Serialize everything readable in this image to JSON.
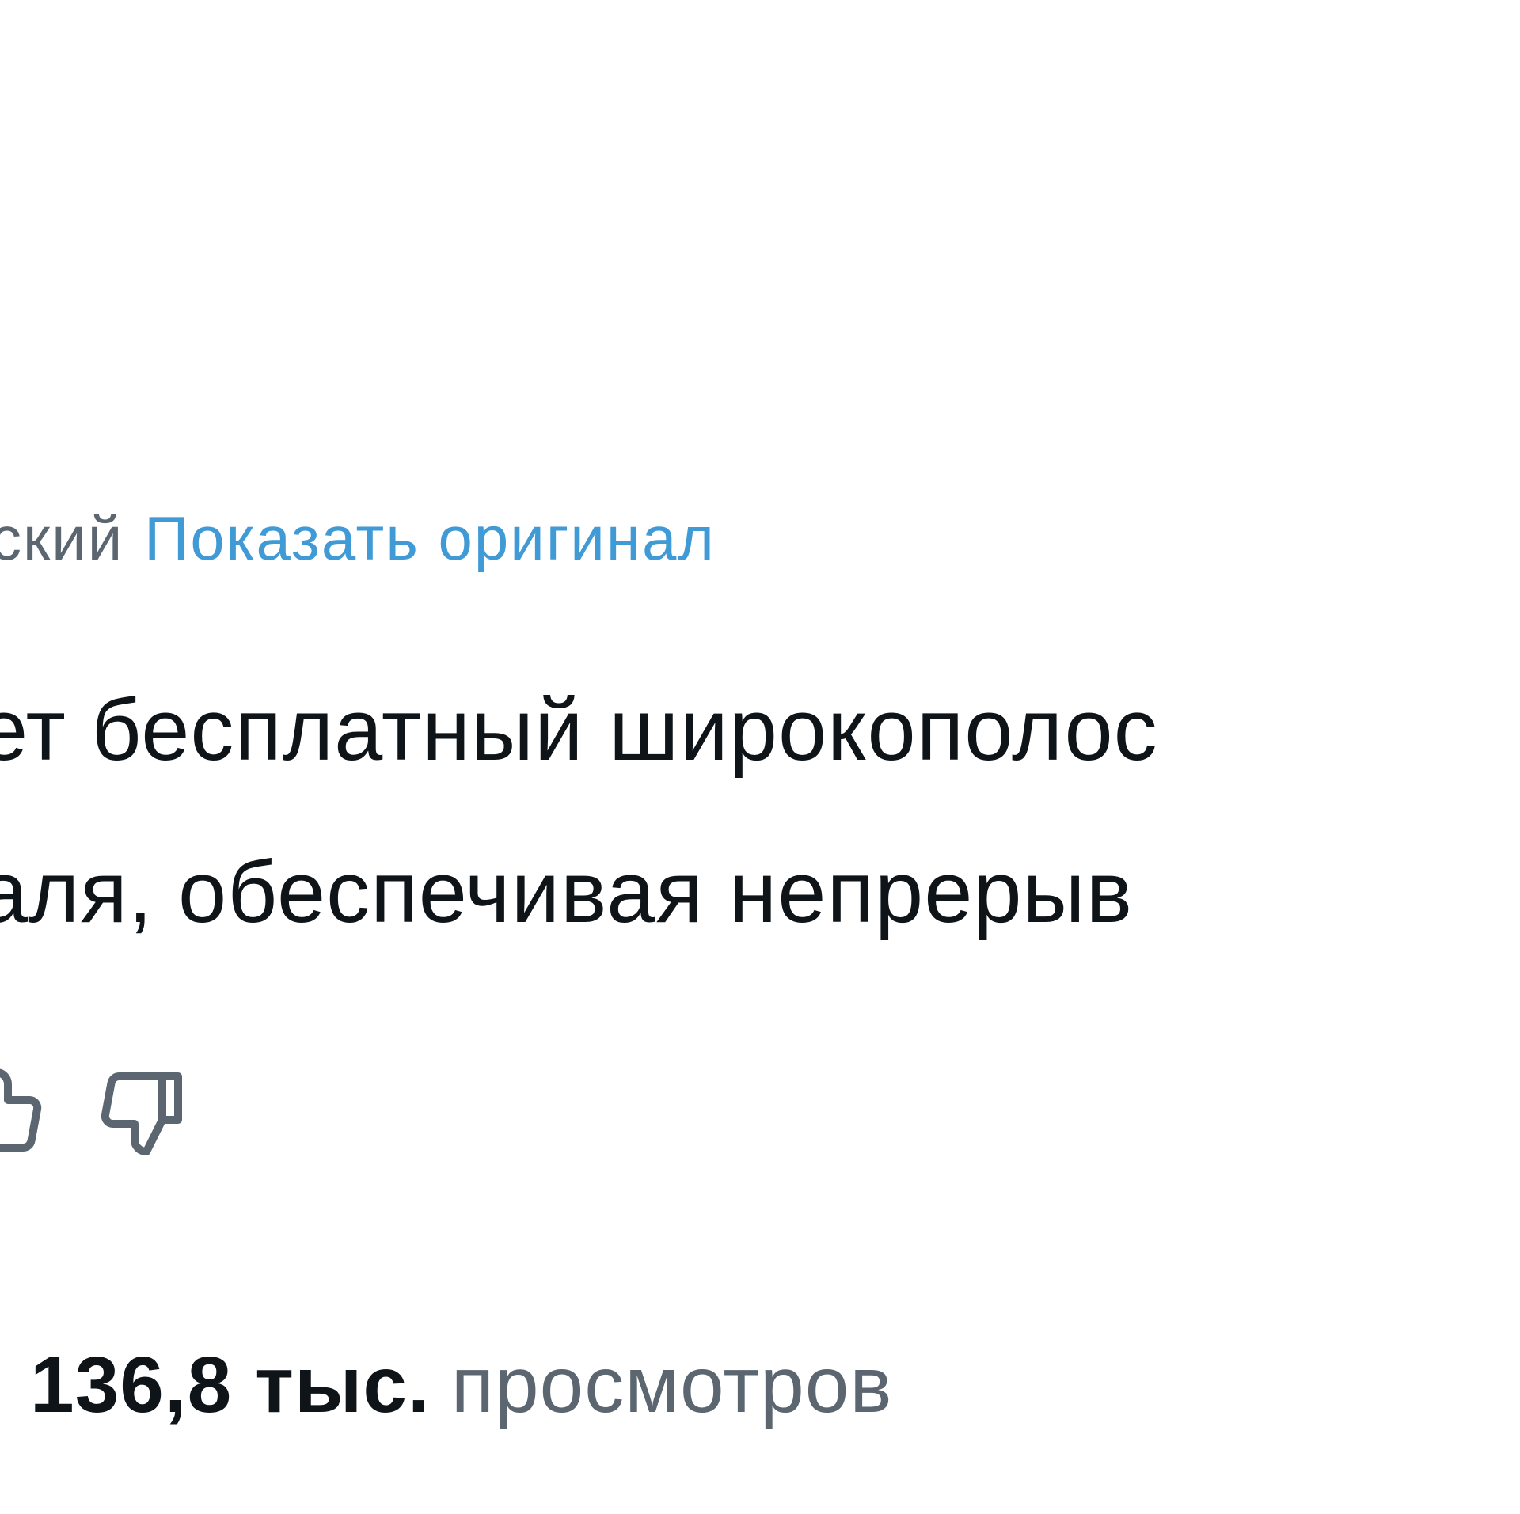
{
  "translation": {
    "language_fragment": "ский",
    "show_original_label": "Показать оригинал",
    "link_color": "#3f9ad6"
  },
  "post": {
    "lines": [
      "ет бесплатный широкополос",
      "аля, обеспечивая непрерыв"
    ]
  },
  "feedback": {
    "thumbs_up_icon": "thumbs-up-icon",
    "thumbs_down_icon": "thumbs-down-icon"
  },
  "stats": {
    "views_count": "136,8 тыс.",
    "views_label": "просмотров"
  }
}
